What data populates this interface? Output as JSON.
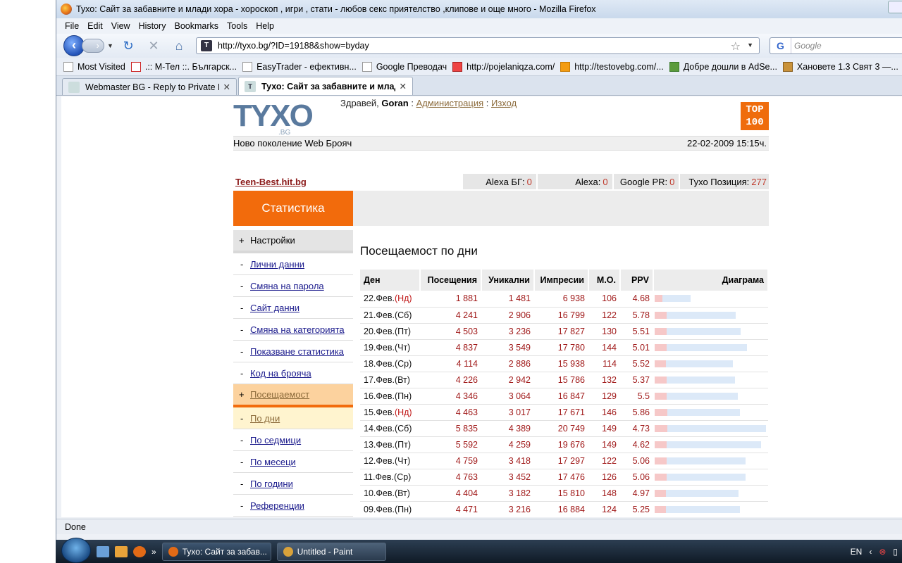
{
  "window": {
    "title": "Тухо: Сайт за забавните и млади хора - хороскоп , игри , стати - любов секс приятелство ,клипове и още много - Mozilla Firefox"
  },
  "menu": [
    "File",
    "Edit",
    "View",
    "History",
    "Bookmarks",
    "Tools",
    "Help"
  ],
  "nav": {
    "url": "http://tyxo.bg/?ID=19188&show=byday",
    "search_placeholder": "Google"
  },
  "bookmarks": [
    "Most Visited",
    ".:: М-Тел ::. Българск...",
    "EasyTrader - ефективн...",
    "Google Преводач",
    "http://pojelaniqza.com/",
    "http://testovebg.com/...",
    "Добре дошли в AdSe...",
    "Хановете 1.3 Свят 3 —..."
  ],
  "tabs": [
    {
      "label": "Webmaster BG - Reply to Private M...",
      "active": false
    },
    {
      "label": "Тухо: Сайт за забавните и млади...",
      "active": true
    }
  ],
  "header": {
    "logo": "TYXO",
    "logo_sub": ".BG",
    "greeting": "Здравей,",
    "user": "Goran",
    "sep": ":",
    "admin_link": "Администрация",
    "sep2": ":",
    "logout_link": "Изход",
    "top100": "TOP\n100",
    "tagline": "Ново поколение Web Брояч",
    "datetime": "22-02-2009 15:15ч."
  },
  "site": {
    "name": "Teen-Best.hit.bg",
    "alexa_bg_label": "Alexa БГ:",
    "alexa_bg": "0",
    "alexa_label": "Alexa:",
    "alexa": "0",
    "pr_label": "Google PR:",
    "pr": "0",
    "pos_label": "Тухо Позиция:",
    "pos": "277"
  },
  "sidebar": {
    "head": "Статистика",
    "sec1": "Настройки",
    "items1": [
      "Лични данни",
      "Смяна на парола",
      "Сайт данни",
      "Смяна на категорията",
      "Показване статистика",
      "Код на брояча"
    ],
    "sec2": "Посещаемост",
    "items2": [
      "По дни",
      "По седмици",
      "По месеци",
      "По години",
      "Референции"
    ]
  },
  "main": {
    "title": "Посещаемост по дни",
    "columns": [
      "Ден",
      "Посещения",
      "Уникални",
      "Импресии",
      "М.О.",
      "PPV",
      "Диаграма"
    ],
    "rows": [
      {
        "day": "22.Фев.",
        "wd": "(Нд)",
        "visits": "1 881",
        "unique": "1 481",
        "imp": "6 938",
        "mo": "106",
        "ppv": "4.68",
        "v": 1881,
        "u": 1481
      },
      {
        "day": "21.Фев.",
        "wd": "(Сб)",
        "visits": "4 241",
        "unique": "2 906",
        "imp": "16 799",
        "mo": "122",
        "ppv": "5.78",
        "v": 4241,
        "u": 2906
      },
      {
        "day": "20.Фев.",
        "wd": "(Пт)",
        "visits": "4 503",
        "unique": "3 236",
        "imp": "17 827",
        "mo": "130",
        "ppv": "5.51",
        "v": 4503,
        "u": 3236
      },
      {
        "day": "19.Фев.",
        "wd": "(Чт)",
        "visits": "4 837",
        "unique": "3 549",
        "imp": "17 780",
        "mo": "144",
        "ppv": "5.01",
        "v": 4837,
        "u": 3549
      },
      {
        "day": "18.Фев.",
        "wd": "(Ср)",
        "visits": "4 114",
        "unique": "2 886",
        "imp": "15 938",
        "mo": "114",
        "ppv": "5.52",
        "v": 4114,
        "u": 2886
      },
      {
        "day": "17.Фев.",
        "wd": "(Вт)",
        "visits": "4 226",
        "unique": "2 942",
        "imp": "15 786",
        "mo": "132",
        "ppv": "5.37",
        "v": 4226,
        "u": 2942
      },
      {
        "day": "16.Фев.",
        "wd": "(Пн)",
        "visits": "4 346",
        "unique": "3 064",
        "imp": "16 847",
        "mo": "129",
        "ppv": "5.5",
        "v": 4346,
        "u": 3064
      },
      {
        "day": "15.Фев.",
        "wd": "(Нд)",
        "visits": "4 463",
        "unique": "3 017",
        "imp": "17 671",
        "mo": "146",
        "ppv": "5.86",
        "v": 4463,
        "u": 3017
      },
      {
        "day": "14.Фев.",
        "wd": "(Сб)",
        "visits": "5 835",
        "unique": "4 389",
        "imp": "20 749",
        "mo": "149",
        "ppv": "4.73",
        "v": 5835,
        "u": 4389
      },
      {
        "day": "13.Фев.",
        "wd": "(Пт)",
        "visits": "5 592",
        "unique": "4 259",
        "imp": "19 676",
        "mo": "149",
        "ppv": "4.62",
        "v": 5592,
        "u": 4259
      },
      {
        "day": "12.Фев.",
        "wd": "(Чт)",
        "visits": "4 759",
        "unique": "3 418",
        "imp": "17 297",
        "mo": "122",
        "ppv": "5.06",
        "v": 4759,
        "u": 3418
      },
      {
        "day": "11.Фев.",
        "wd": "(Ср)",
        "visits": "4 763",
        "unique": "3 452",
        "imp": "17 476",
        "mo": "126",
        "ppv": "5.06",
        "v": 4763,
        "u": 3452
      },
      {
        "day": "10.Фев.",
        "wd": "(Вт)",
        "visits": "4 404",
        "unique": "3 182",
        "imp": "15 810",
        "mo": "148",
        "ppv": "4.97",
        "v": 4404,
        "u": 3182
      },
      {
        "day": "09.Фев.",
        "wd": "(Пн)",
        "visits": "4 471",
        "unique": "3 216",
        "imp": "16 884",
        "mo": "124",
        "ppv": "5.25",
        "v": 4471,
        "u": 3216
      }
    ]
  },
  "status": "Done",
  "taskbar": {
    "btn1": "Тухо: Сайт за забав...",
    "btn2": "Untitled - Paint",
    "lang": "EN",
    "quick_more": "»"
  }
}
